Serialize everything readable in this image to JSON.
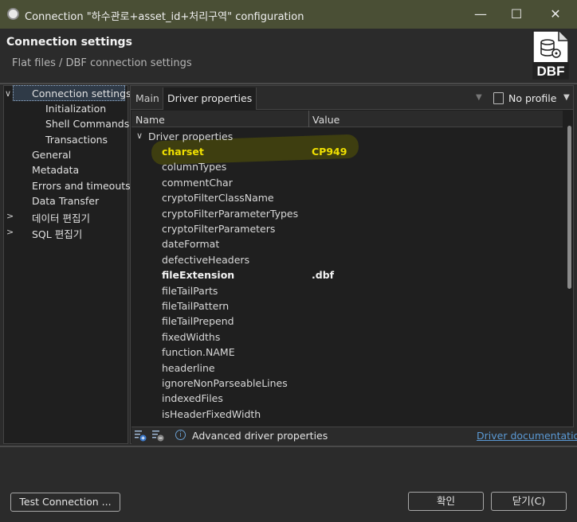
{
  "window": {
    "title": "Connection \"하수관로+asset_id+처리구역\" configuration",
    "minimize": "—",
    "maximize": "☐",
    "close": "✕"
  },
  "header": {
    "title": "Connection settings",
    "subtitle": "Flat files / DBF connection settings",
    "logo_text": "DBF"
  },
  "tree": {
    "items": [
      {
        "label": "Connection settings",
        "expanded": true,
        "selected": true
      },
      {
        "label": "Initialization"
      },
      {
        "label": "Shell Commands"
      },
      {
        "label": "Transactions"
      },
      {
        "label": "General"
      },
      {
        "label": "Metadata"
      },
      {
        "label": "Errors and timeouts"
      },
      {
        "label": "Data Transfer"
      },
      {
        "label": "데이터 편집기",
        "collapsed": true
      },
      {
        "label": "SQL 편집기",
        "collapsed": true
      }
    ]
  },
  "tabs": {
    "main": "Main",
    "driver": "Driver properties",
    "profile": "No profile"
  },
  "table": {
    "col_name": "Name",
    "col_value": "Value",
    "group": "Driver properties",
    "rows": [
      {
        "name": "charset",
        "value": "CP949"
      },
      {
        "name": "columnTypes",
        "value": ""
      },
      {
        "name": "commentChar",
        "value": ""
      },
      {
        "name": "cryptoFilterClassName",
        "value": ""
      },
      {
        "name": "cryptoFilterParameterTypes",
        "value": ""
      },
      {
        "name": "cryptoFilterParameters",
        "value": ""
      },
      {
        "name": "dateFormat",
        "value": ""
      },
      {
        "name": "defectiveHeaders",
        "value": ""
      },
      {
        "name": "fileExtension",
        "value": ".dbf"
      },
      {
        "name": "fileTailParts",
        "value": ""
      },
      {
        "name": "fileTailPattern",
        "value": ""
      },
      {
        "name": "fileTailPrepend",
        "value": ""
      },
      {
        "name": "fixedWidths",
        "value": ""
      },
      {
        "name": "function.NAME",
        "value": ""
      },
      {
        "name": "headerline",
        "value": ""
      },
      {
        "name": "ignoreNonParseableLines",
        "value": ""
      },
      {
        "name": "indexedFiles",
        "value": ""
      },
      {
        "name": "isHeaderFixedWidth",
        "value": ""
      }
    ]
  },
  "footer": {
    "advanced_label": "Advanced driver properties",
    "doc_link": "Driver documentation"
  },
  "buttons": {
    "test": "Test Connection ...",
    "ok": "확인",
    "close": "닫기(C)"
  },
  "colors": {
    "highlight_text": "#f0e000",
    "link": "#5b9ad6"
  }
}
